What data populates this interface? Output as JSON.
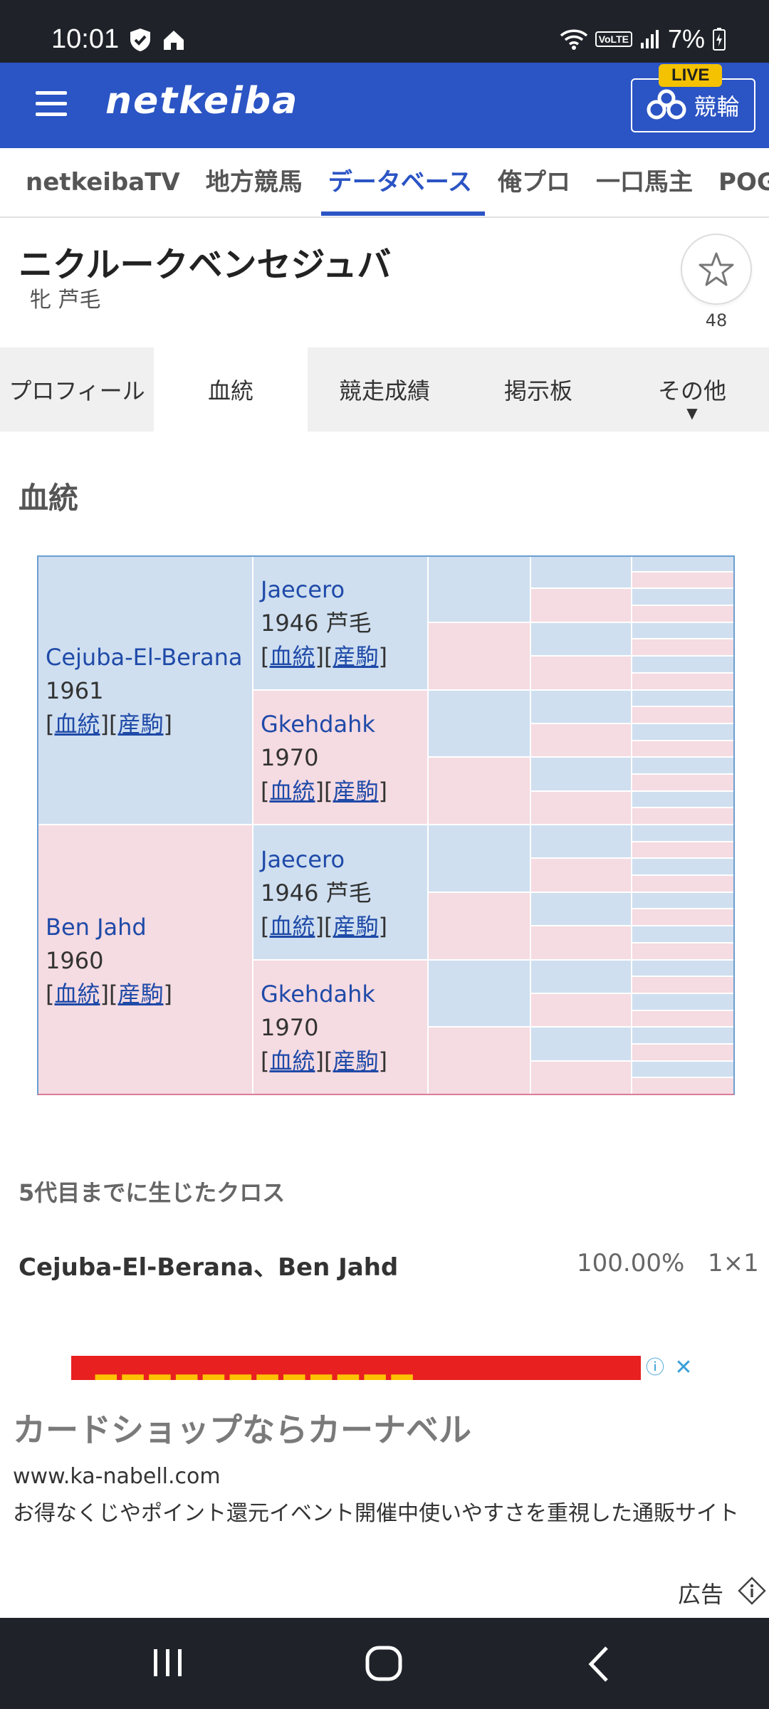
{
  "status_bar": {
    "time": "10:01",
    "battery": "7%"
  },
  "header": {
    "logo": "netkeiba",
    "keirin_label": "競輪",
    "live_badge": "LIVE"
  },
  "site_nav": [
    "netkeibaTV",
    "地方競馬",
    "データベース",
    "俺プロ",
    "一口馬主",
    "POG"
  ],
  "site_nav_active": "データベース",
  "horse": {
    "name": "ニクルークベンセジュバ",
    "meta": "牝  芦毛",
    "favorite_count": "48"
  },
  "tabs": [
    "プロフィール",
    "血統",
    "競走成績",
    "掲示板",
    "その他"
  ],
  "tab_active": "血統",
  "section_title": "血統",
  "pedigree": {
    "link_bloodline": "血統",
    "link_offspring": "産駒",
    "gen1": [
      {
        "name": "Cejuba-El-Berana",
        "year": "1961",
        "sex": "m"
      },
      {
        "name": "Ben Jahd",
        "year": "1960",
        "sex": "f"
      }
    ],
    "gen2": [
      {
        "name": "Jaecero",
        "year": "1946 芦毛",
        "sex": "m"
      },
      {
        "name": "Gkehdahk",
        "year": "1970",
        "sex": "f"
      },
      {
        "name": "Jaecero",
        "year": "1946 芦毛",
        "sex": "m"
      },
      {
        "name": "Gkehdahk",
        "year": "1970",
        "sex": "f"
      }
    ]
  },
  "cross": {
    "title": "5代目までに生じたクロス",
    "name": "Cejuba-El-Berana、Ben Jahd",
    "percent": "100.00%",
    "repeat": "1×1"
  },
  "ad": {
    "title": "カードショップならカーナベル",
    "url": "www.ka-nabell.com",
    "description": "お得なくじやポイント還元イベント開催中使いやすさを重視した通販サイト",
    "label": "広告"
  },
  "colors": {
    "header": "#2b54c4",
    "male_cell": "#cfdff0",
    "female_cell": "#f5dbe2",
    "link": "#1f4aa8"
  },
  "icons": {
    "menu": "hamburger-icon",
    "favorite": "star-icon",
    "keirin": "bicycle-logo-icon"
  }
}
